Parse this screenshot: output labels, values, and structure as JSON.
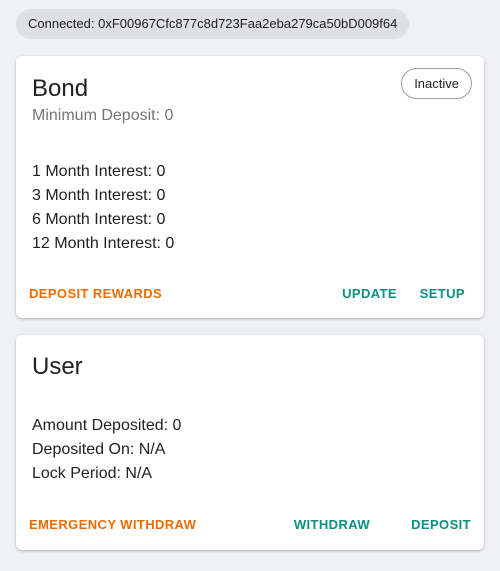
{
  "connection": {
    "label": "Connected: 0xF00967Cfc877c8d723Faa2eba279ca50bD009f64"
  },
  "bond": {
    "title": "Bond",
    "status": "Inactive",
    "subheader": "Minimum Deposit: 0",
    "lines": [
      "1 Month Interest: 0",
      "3 Month Interest: 0",
      "6 Month Interest: 0",
      "12 Month Interest: 0"
    ],
    "actions": {
      "deposit_rewards": "Deposit Rewards",
      "update": "Update",
      "setup": "Setup"
    }
  },
  "user": {
    "title": "User",
    "lines": [
      "Amount Deposited: 0",
      "Deposited On: N/A",
      "Lock Period: N/A"
    ],
    "actions": {
      "emergency_withdraw": "Emergency Withdraw",
      "withdraw": "Withdraw",
      "deposit": "Deposit"
    }
  },
  "colors": {
    "warning": "#ed6c02",
    "primary": "#0b8f80",
    "background": "#f0f1f4"
  }
}
